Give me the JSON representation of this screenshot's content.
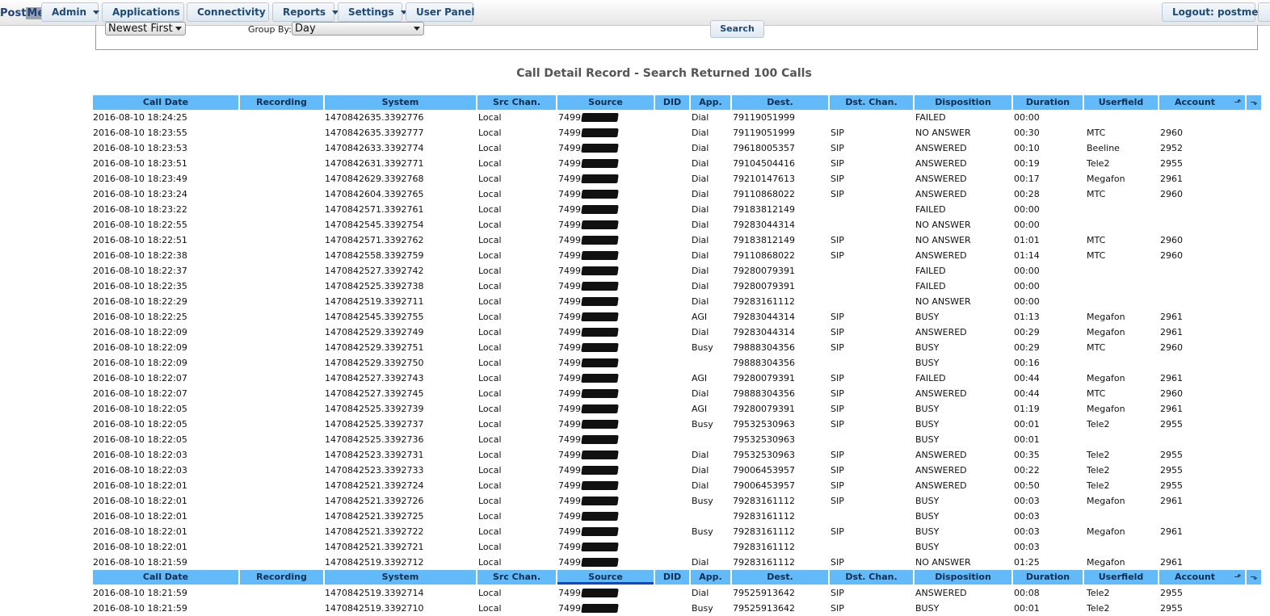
{
  "nav": {
    "logo_part1": "Post",
    "logo_part2": "Met",
    "items": [
      {
        "label": "Admin",
        "dropdown": true
      },
      {
        "label": "Applications",
        "dropdown": true
      },
      {
        "label": "Connectivity",
        "dropdown": true
      },
      {
        "label": "Reports",
        "dropdown": true
      },
      {
        "label": "Settings",
        "dropdown": true
      },
      {
        "label": "User Panel",
        "dropdown": false
      }
    ],
    "logout": "Logout: postmet"
  },
  "search": {
    "order_value": "Newest First",
    "group_by_label": "Group By:",
    "group_by_value": "Day",
    "search_button": "Search"
  },
  "title": "Call Detail Record - Search Returned 100 Calls",
  "columns": [
    "Call Date",
    "Recording",
    "System",
    "Src Chan.",
    "Source",
    "DID",
    "App.",
    "Dest.",
    "Dst. Chan.",
    "Disposition",
    "Duration",
    "Userfield",
    "Account"
  ],
  "sorted_column": "Source",
  "rows": [
    [
      "2016-08-10 18:24:25",
      "",
      "1470842635.3392776",
      "Local",
      "7499",
      "",
      "Dial",
      "79119051999",
      "",
      "FAILED",
      "00:00",
      "",
      ""
    ],
    [
      "2016-08-10 18:23:55",
      "",
      "1470842635.3392777",
      "Local",
      "7499",
      "",
      "Dial",
      "79119051999",
      "SIP",
      "NO ANSWER",
      "00:30",
      "MTC",
      "2960"
    ],
    [
      "2016-08-10 18:23:53",
      "",
      "1470842633.3392774",
      "Local",
      "7499",
      "",
      "Dial",
      "79618005357",
      "SIP",
      "ANSWERED",
      "00:10",
      "Beeline",
      "2952"
    ],
    [
      "2016-08-10 18:23:51",
      "",
      "1470842631.3392771",
      "Local",
      "7499",
      "",
      "Dial",
      "79104504416",
      "SIP",
      "ANSWERED",
      "00:19",
      "Tele2",
      "2955"
    ],
    [
      "2016-08-10 18:23:49",
      "",
      "1470842629.3392768",
      "Local",
      "7499",
      "",
      "Dial",
      "79210147613",
      "SIP",
      "ANSWERED",
      "00:17",
      "Megafon",
      "2961"
    ],
    [
      "2016-08-10 18:23:24",
      "",
      "1470842604.3392765",
      "Local",
      "7499",
      "",
      "Dial",
      "79110868022",
      "SIP",
      "ANSWERED",
      "00:28",
      "MTC",
      "2960"
    ],
    [
      "2016-08-10 18:23:22",
      "",
      "1470842571.3392761",
      "Local",
      "7499",
      "",
      "Dial",
      "79183812149",
      "",
      "FAILED",
      "00:00",
      "",
      ""
    ],
    [
      "2016-08-10 18:22:55",
      "",
      "1470842545.3392754",
      "Local",
      "7499",
      "",
      "Dial",
      "79283044314",
      "",
      "NO ANSWER",
      "00:00",
      "",
      ""
    ],
    [
      "2016-08-10 18:22:51",
      "",
      "1470842571.3392762",
      "Local",
      "7499",
      "",
      "Dial",
      "79183812149",
      "SIP",
      "NO ANSWER",
      "01:01",
      "MTC",
      "2960"
    ],
    [
      "2016-08-10 18:22:38",
      "",
      "1470842558.3392759",
      "Local",
      "7499",
      "",
      "Dial",
      "79110868022",
      "SIP",
      "ANSWERED",
      "01:14",
      "MTC",
      "2960"
    ],
    [
      "2016-08-10 18:22:37",
      "",
      "1470842527.3392742",
      "Local",
      "7499",
      "",
      "Dial",
      "79280079391",
      "",
      "FAILED",
      "00:00",
      "",
      ""
    ],
    [
      "2016-08-10 18:22:35",
      "",
      "1470842525.3392738",
      "Local",
      "7499",
      "",
      "Dial",
      "79280079391",
      "",
      "FAILED",
      "00:00",
      "",
      ""
    ],
    [
      "2016-08-10 18:22:29",
      "",
      "1470842519.3392711",
      "Local",
      "7499",
      "",
      "Dial",
      "79283161112",
      "",
      "NO ANSWER",
      "00:00",
      "",
      ""
    ],
    [
      "2016-08-10 18:22:25",
      "",
      "1470842545.3392755",
      "Local",
      "7499",
      "",
      "AGI",
      "79283044314",
      "SIP",
      "BUSY",
      "01:13",
      "Megafon",
      "2961"
    ],
    [
      "2016-08-10 18:22:09",
      "",
      "1470842529.3392749",
      "Local",
      "7499",
      "",
      "Dial",
      "79283044314",
      "SIP",
      "ANSWERED",
      "00:29",
      "Megafon",
      "2961"
    ],
    [
      "2016-08-10 18:22:09",
      "",
      "1470842529.3392751",
      "Local",
      "7499",
      "",
      "Busy",
      "79888304356",
      "SIP",
      "BUSY",
      "00:29",
      "MTC",
      "2960"
    ],
    [
      "2016-08-10 18:22:09",
      "",
      "1470842529.3392750",
      "Local",
      "7499",
      "",
      "",
      "79888304356",
      "",
      "BUSY",
      "00:16",
      "",
      ""
    ],
    [
      "2016-08-10 18:22:07",
      "",
      "1470842527.3392743",
      "Local",
      "7499",
      "",
      "AGI",
      "79280079391",
      "SIP",
      "FAILED",
      "00:44",
      "Megafon",
      "2961"
    ],
    [
      "2016-08-10 18:22:07",
      "",
      "1470842527.3392745",
      "Local",
      "7499",
      "",
      "Dial",
      "79888304356",
      "SIP",
      "ANSWERED",
      "00:44",
      "MTC",
      "2960"
    ],
    [
      "2016-08-10 18:22:05",
      "",
      "1470842525.3392739",
      "Local",
      "7499",
      "",
      "AGI",
      "79280079391",
      "SIP",
      "BUSY",
      "01:19",
      "Megafon",
      "2961"
    ],
    [
      "2016-08-10 18:22:05",
      "",
      "1470842525.3392737",
      "Local",
      "7499",
      "",
      "Busy",
      "79532530963",
      "SIP",
      "BUSY",
      "00:01",
      "Tele2",
      "2955"
    ],
    [
      "2016-08-10 18:22:05",
      "",
      "1470842525.3392736",
      "Local",
      "7499",
      "",
      "",
      "79532530963",
      "",
      "BUSY",
      "00:01",
      "",
      ""
    ],
    [
      "2016-08-10 18:22:03",
      "",
      "1470842523.3392731",
      "Local",
      "7499",
      "",
      "Dial",
      "79532530963",
      "SIP",
      "ANSWERED",
      "00:35",
      "Tele2",
      "2955"
    ],
    [
      "2016-08-10 18:22:03",
      "",
      "1470842523.3392733",
      "Local",
      "7499",
      "",
      "Dial",
      "79006453957",
      "SIP",
      "ANSWERED",
      "00:22",
      "Tele2",
      "2955"
    ],
    [
      "2016-08-10 18:22:01",
      "",
      "1470842521.3392724",
      "Local",
      "7499",
      "",
      "Dial",
      "79006453957",
      "SIP",
      "ANSWERED",
      "00:50",
      "Tele2",
      "2955"
    ],
    [
      "2016-08-10 18:22:01",
      "",
      "1470842521.3392726",
      "Local",
      "7499",
      "",
      "Busy",
      "79283161112",
      "SIP",
      "BUSY",
      "00:03",
      "Megafon",
      "2961"
    ],
    [
      "2016-08-10 18:22:01",
      "",
      "1470842521.3392725",
      "Local",
      "7499",
      "",
      "",
      "79283161112",
      "",
      "BUSY",
      "00:03",
      "",
      ""
    ],
    [
      "2016-08-10 18:22:01",
      "",
      "1470842521.3392722",
      "Local",
      "7499",
      "",
      "Busy",
      "79283161112",
      "SIP",
      "BUSY",
      "00:03",
      "Megafon",
      "2961"
    ],
    [
      "2016-08-10 18:22:01",
      "",
      "1470842521.3392721",
      "Local",
      "7499",
      "",
      "",
      "79283161112",
      "",
      "BUSY",
      "00:03",
      "",
      ""
    ],
    [
      "2016-08-10 18:21:59",
      "",
      "1470842519.3392712",
      "Local",
      "7499",
      "",
      "Dial",
      "79283161112",
      "SIP",
      "NO ANSWER",
      "01:25",
      "Megafon",
      "2961"
    ]
  ],
  "rows_after_header": [
    [
      "2016-08-10 18:21:59",
      "",
      "1470842519.3392714",
      "Local",
      "7499",
      "",
      "Dial",
      "79525913642",
      "SIP",
      "ANSWERED",
      "00:08",
      "Tele2",
      "2955"
    ],
    [
      "2016-08-10 18:21:59",
      "",
      "1470842519.3392710",
      "Local",
      "7499",
      "",
      "Busy",
      "79525913642",
      "SIP",
      "BUSY",
      "00:01",
      "Tele2",
      "2955"
    ]
  ],
  "icons": {
    "sort_asc": "sort-up-icon",
    "sort_desc": "sort-down-icon",
    "redaction": "redacted-number"
  }
}
